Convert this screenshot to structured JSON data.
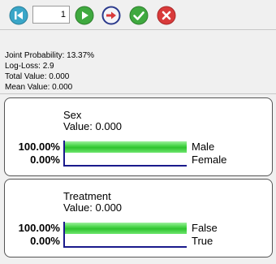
{
  "toolbar": {
    "record_number": "1",
    "buttons": [
      {
        "icon": "skip-to-first-icon",
        "color": "#3aa6c8"
      },
      {
        "icon": "play-icon",
        "color": "#3fa93f"
      },
      {
        "icon": "go-to-record-icon",
        "color": "#2b3a8c"
      },
      {
        "icon": "check-icon",
        "color": "#3fa93f"
      },
      {
        "icon": "close-icon",
        "color": "#d93a3a"
      }
    ]
  },
  "stats": {
    "joint_probability": "Joint Probability: 13.37%",
    "log_loss": "Log-Loss: 2.9",
    "total_value": "Total Value: 0.000",
    "mean_value": "Mean Value: 0.000"
  },
  "nodes": [
    {
      "title": "Sex",
      "value": "Value: 0.000",
      "states": [
        {
          "percent": "100.00%",
          "label": "Male",
          "probability": 1.0
        },
        {
          "percent": "0.00%",
          "label": "Female",
          "probability": 0.0
        }
      ]
    },
    {
      "title": "Treatment",
      "value": "Value: 0.000",
      "states": [
        {
          "percent": "100.00%",
          "label": "False",
          "probability": 1.0
        },
        {
          "percent": "0.00%",
          "label": "True",
          "probability": 0.0
        }
      ]
    }
  ],
  "colors": {
    "bar_fill": "#3fcf3f",
    "bar_axis": "#1a1a8c"
  }
}
